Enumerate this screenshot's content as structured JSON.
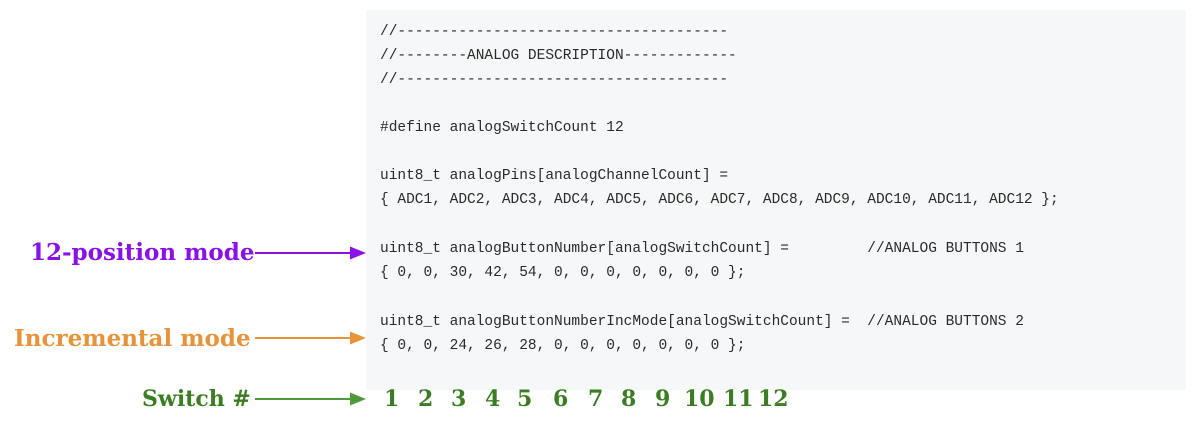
{
  "code": {
    "lines": [
      "//--------------------------------------",
      "//--------ANALOG DESCRIPTION-------------",
      "//--------------------------------------",
      "",
      "#define analogSwitchCount 12",
      "",
      "uint8_t analogPins[analogChannelCount] =",
      "{ ADC1, ADC2, ADC3, ADC4, ADC5, ADC6, ADC7, ADC8, ADC9, ADC10, ADC11, ADC12 };",
      "",
      "uint8_t analogButtonNumber[analogSwitchCount] =         //ANALOG BUTTONS 1",
      "{ 0, 0, 30, 42, 54, 0, 0, 0, 0, 0, 0, 0 };",
      "",
      "uint8_t analogButtonNumberIncMode[analogSwitchCount] =  //ANALOG BUTTONS 2",
      "{ 0, 0, 24, 26, 28, 0, 0, 0, 0, 0, 0, 0 };"
    ]
  },
  "annotations": {
    "position_mode": {
      "label": "12-position mode",
      "color": "#8a10e8"
    },
    "incremental_mode": {
      "label": "Incremental mode",
      "color": "#e8933a"
    },
    "switch_number": {
      "label": "Switch #",
      "color": "#3a7d23"
    }
  },
  "switch_numbers": [
    "1",
    "2",
    "3",
    "4",
    "5",
    "6",
    "7",
    "8",
    "9",
    "10",
    "11",
    "12"
  ]
}
